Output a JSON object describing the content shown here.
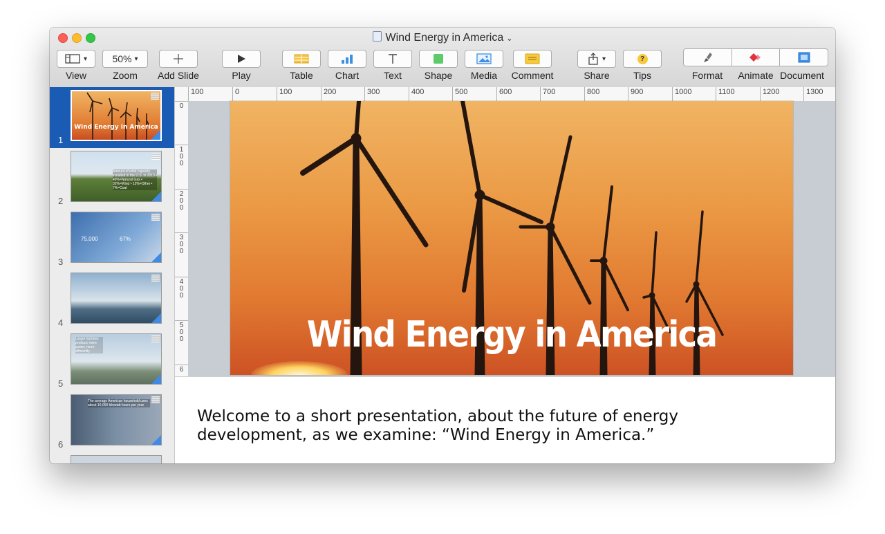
{
  "window": {
    "title": "Wind Energy in America"
  },
  "toolbar": {
    "view_label": "View",
    "zoom_value": "50%",
    "zoom_label": "Zoom",
    "add_slide_label": "Add Slide",
    "play_label": "Play",
    "table_label": "Table",
    "chart_label": "Chart",
    "text_label": "Text",
    "shape_label": "Shape",
    "media_label": "Media",
    "comment_label": "Comment",
    "share_label": "Share",
    "tips_label": "Tips",
    "tips_icon_text": "?",
    "format_label": "Format",
    "animate_label": "Animate",
    "document_label": "Document"
  },
  "icons": {
    "view": "sidebar-layout-icon",
    "add_slide": "plus-icon",
    "play": "play-icon",
    "table": "table-icon",
    "chart": "bar-chart-icon",
    "text": "text-t-icon",
    "shape": "square-icon",
    "media": "photo-icon",
    "comment": "comment-icon",
    "share": "share-icon",
    "tips": "question-icon",
    "format": "paintbrush-icon",
    "animate": "diamond-icon",
    "document": "document-icon"
  },
  "colors": {
    "selection": "#1a5bb4",
    "accent_blue": "#3f8ae6",
    "slide_orange": "#eb9a45",
    "shape_green": "#5dcb6c",
    "comment_yellow": "#f7c93b",
    "animate_red": "#e0323f"
  },
  "navigator": {
    "slides": [
      {
        "number": "1",
        "caption": "Wind Energy in America",
        "selected": true
      },
      {
        "number": "2",
        "text": "Amount of wind capacity installed in the U.S. in 2013 • 49%=Natural Gas • 32%=Wind • 12%=Other • 7%=Coal"
      },
      {
        "number": "3",
        "stat1": "75,000",
        "stat2": "67%"
      },
      {
        "number": "4"
      },
      {
        "number": "5",
        "text": "Larger turbines produce more power, more efficiently"
      },
      {
        "number": "6",
        "text": "The average American household uses about 10,000 kilowatt-hours per year"
      }
    ]
  },
  "ruler": {
    "horizontal": [
      "100",
      "0",
      "100",
      "200",
      "300",
      "400",
      "500",
      "600",
      "700",
      "800",
      "900",
      "1000",
      "1100",
      "1200",
      "1300"
    ],
    "vertical": [
      "0",
      "1\n0\n0",
      "2\n0\n0",
      "3\n0\n0",
      "4\n0\n0",
      "5\n0\n0",
      "6"
    ]
  },
  "slide": {
    "title": "Wind Energy in America"
  },
  "notes": {
    "text": "Welcome to a short presentation, about the future of energy development, as we examine: “Wind Energy in America.”"
  }
}
